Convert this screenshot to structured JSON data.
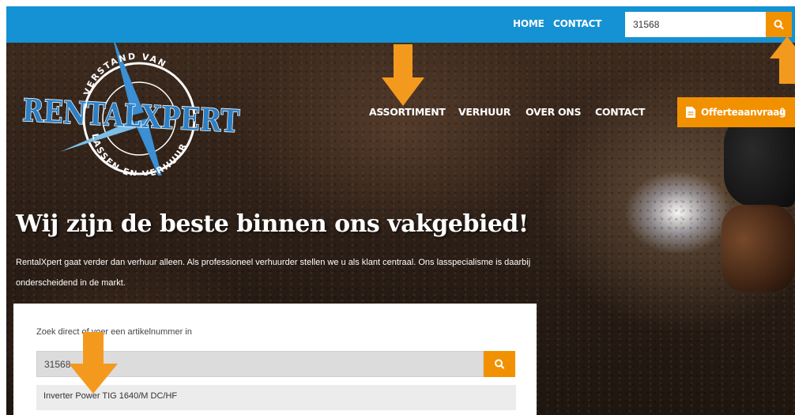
{
  "topbar": {
    "links": [
      "HOME",
      "CONTACT"
    ],
    "search_value": "31568"
  },
  "logo": {
    "brand": "RENTALXPERT",
    "ring_top": "VERSTAND VAN",
    "ring_bottom": "LASSEN EN VERHUUR"
  },
  "nav": {
    "items": [
      "ASSORTIMENT",
      "VERHUUR",
      "OVER ONS",
      "CONTACT"
    ]
  },
  "quote": {
    "label": "Offerteaanvraag",
    "count": "0"
  },
  "hero": {
    "title": "Wij zijn de beste binnen ons vakgebied!",
    "text": "RentalXpert gaat verder dan verhuur alleen. Als professioneel verhuurder stellen we u als klant centraal. Ons lasspecialisme is daarbij onderscheidend in de markt."
  },
  "search_card": {
    "label": "Zoek direct of voer een artikelnummer in",
    "value": "31568",
    "suggestion": "Inverter Power TIG 1640/M DC/HF"
  },
  "colors": {
    "topbar": "#1592d3",
    "accent": "#f29100"
  },
  "icons": [
    "search-icon",
    "document-icon",
    "down-arrow-icon",
    "up-arrow-icon"
  ]
}
